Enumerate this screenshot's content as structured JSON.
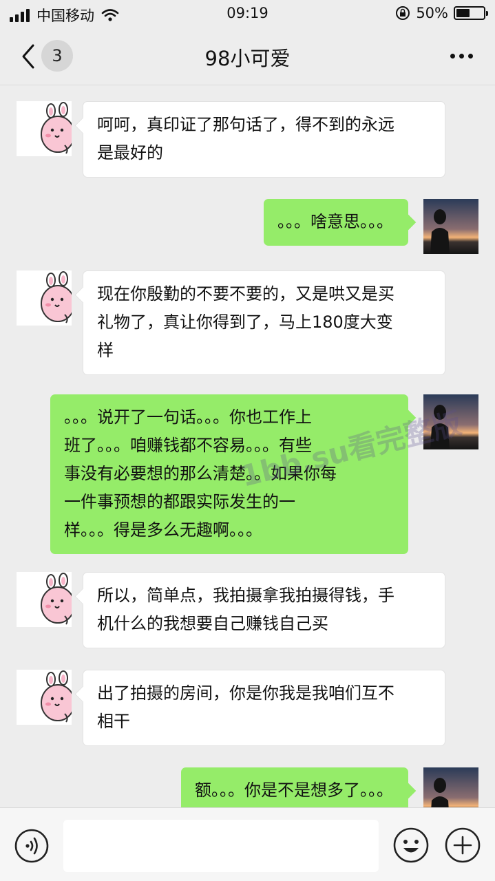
{
  "status_bar": {
    "carrier": "中国移动",
    "time": "09:19",
    "battery_percent": "50%",
    "battery_level": 0.5
  },
  "nav": {
    "unread_count": "3",
    "title": "98小可爱"
  },
  "messages": [
    {
      "side": "in",
      "text": "呵呵，真印证了那句话了，得不到的永远\n是最好的"
    },
    {
      "side": "out",
      "text": "。。。啥意思。。。"
    },
    {
      "side": "in",
      "text": "现在你殷勤的不要不要的，又是哄又是买\n礼物了，真让你得到了，马上180度大变\n样"
    },
    {
      "side": "out",
      "text": "。。。说开了一句话。。。你也工作上\n班了。。。咱赚钱都不容易。。。有些\n事没有必要想的那么清楚。。如果你每\n一件事预想的都跟实际发生的一\n样。。。得是多么无趣啊。。。"
    },
    {
      "side": "in",
      "text": "所以，简单点，我拍摄拿我拍摄得钱，手\n机什么的我想要自己赚钱自己买"
    },
    {
      "side": "in",
      "text": "出了拍摄的房间，你是你我是我咱们互不\n相干"
    },
    {
      "side": "out",
      "text": "额。。。你是不是想多了。。。"
    }
  ],
  "watermark": "1bb.su看完整版",
  "input_bar": {
    "text_value": ""
  },
  "colors": {
    "outgoing_bubble": "#95ec69",
    "incoming_bubble": "#ffffff",
    "background": "#ededed"
  },
  "icons": {
    "back": "chevron-left-icon",
    "more": "more-dots-icon",
    "voice": "voice-icon",
    "emoji": "emoji-icon",
    "plus": "plus-icon",
    "contact_avatar": "pink-bunny-avatar",
    "self_avatar": "silhouette-sunset-avatar"
  }
}
